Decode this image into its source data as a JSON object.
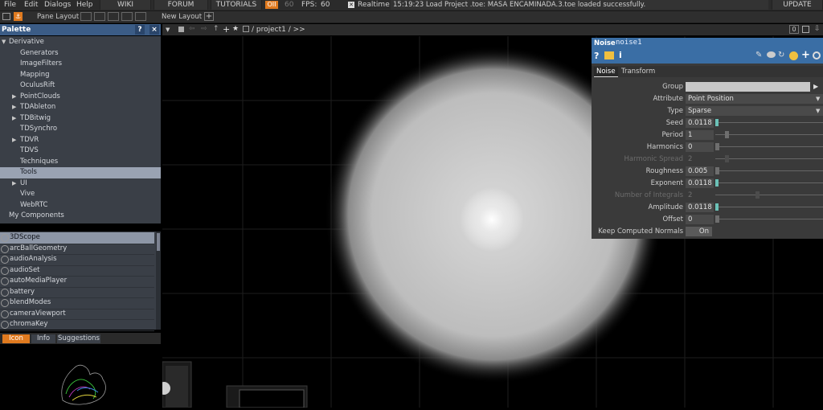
{
  "menubar": {
    "items": [
      "File",
      "Edit",
      "Dialogs",
      "Help"
    ],
    "buttons": [
      "WIKI",
      "FORUM",
      "TUTORIALS"
    ],
    "oi_label": "OII",
    "fps_cook": "60",
    "fps_label": "FPS:",
    "fps_value": "60",
    "realtime_label": "Realtime",
    "status_text": "15:19:23 Load Project .toe: MASA ENCAMINADA.3.toe loaded successfully.",
    "update_label": "UPDATE"
  },
  "toolbar": {
    "pane_layout_label": "Pane Layout",
    "new_layout_label": "New Layout",
    "add_label": "+"
  },
  "palette": {
    "title": "Palette",
    "help": "?",
    "close": "×",
    "tree": [
      {
        "label": "Derivative",
        "indent": 0,
        "expanded": true
      },
      {
        "label": "Generators",
        "indent": 2
      },
      {
        "label": "ImageFilters",
        "indent": 2
      },
      {
        "label": "Mapping",
        "indent": 2
      },
      {
        "label": "OculusRift",
        "indent": 2
      },
      {
        "label": "PointClouds",
        "indent": 2,
        "collapsed": true
      },
      {
        "label": "TDAbleton",
        "indent": 2,
        "collapsed": true
      },
      {
        "label": "TDBitwig",
        "indent": 2,
        "collapsed": true
      },
      {
        "label": "TDSynchro",
        "indent": 2
      },
      {
        "label": "TDVR",
        "indent": 2,
        "collapsed": true
      },
      {
        "label": "TDVS",
        "indent": 2
      },
      {
        "label": "Techniques",
        "indent": 2
      },
      {
        "label": "Tools",
        "indent": 2,
        "selected": true
      },
      {
        "label": "UI",
        "indent": 2,
        "collapsed": true
      },
      {
        "label": "Vive",
        "indent": 2
      },
      {
        "label": "WebRTC",
        "indent": 2
      },
      {
        "label": "My Components",
        "indent": 1
      }
    ],
    "components": [
      "3DScope",
      "arcBallGeometry",
      "audioAnalysis",
      "audioSet",
      "autoMediaPlayer",
      "battery",
      "blendModes",
      "cameraViewport",
      "chromaKey"
    ],
    "tabs": [
      "Icon",
      "Info",
      "Suggestions"
    ]
  },
  "viewer": {
    "path": "/ project1 / >>",
    "counter": "0"
  },
  "param": {
    "op_type": "Noise",
    "op_name": "noise1",
    "tabs": [
      "Noise",
      "Transform"
    ],
    "rows": [
      {
        "label": "Group",
        "value": "",
        "kind": "group"
      },
      {
        "label": "Attribute",
        "value": "Point Position",
        "kind": "menu"
      },
      {
        "label": "Type",
        "value": "Sparse",
        "kind": "menu"
      },
      {
        "label": "Seed",
        "value": "0.0118",
        "kind": "teal"
      },
      {
        "label": "Period",
        "value": "1",
        "kind": "slider"
      },
      {
        "label": "Harmonics",
        "value": "0",
        "kind": "short"
      },
      {
        "label": "Harmonic Spread",
        "value": "2",
        "kind": "dim"
      },
      {
        "label": "Roughness",
        "value": "0.005",
        "kind": "short"
      },
      {
        "label": "Exponent",
        "value": "0.0118",
        "kind": "teal"
      },
      {
        "label": "Number of Integrals",
        "value": "2",
        "kind": "dimslider"
      },
      {
        "label": "Amplitude",
        "value": "0.0118",
        "kind": "teal"
      },
      {
        "label": "Offset",
        "value": "0",
        "kind": "short"
      },
      {
        "label": "Keep Computed Normals",
        "value": "On",
        "kind": "toggle"
      }
    ]
  },
  "colors": {
    "palette_header": "#3b5c86",
    "param_header": "#3a6ea5",
    "accent_orange": "#e07a1f",
    "teal": "#6bc1b7"
  }
}
